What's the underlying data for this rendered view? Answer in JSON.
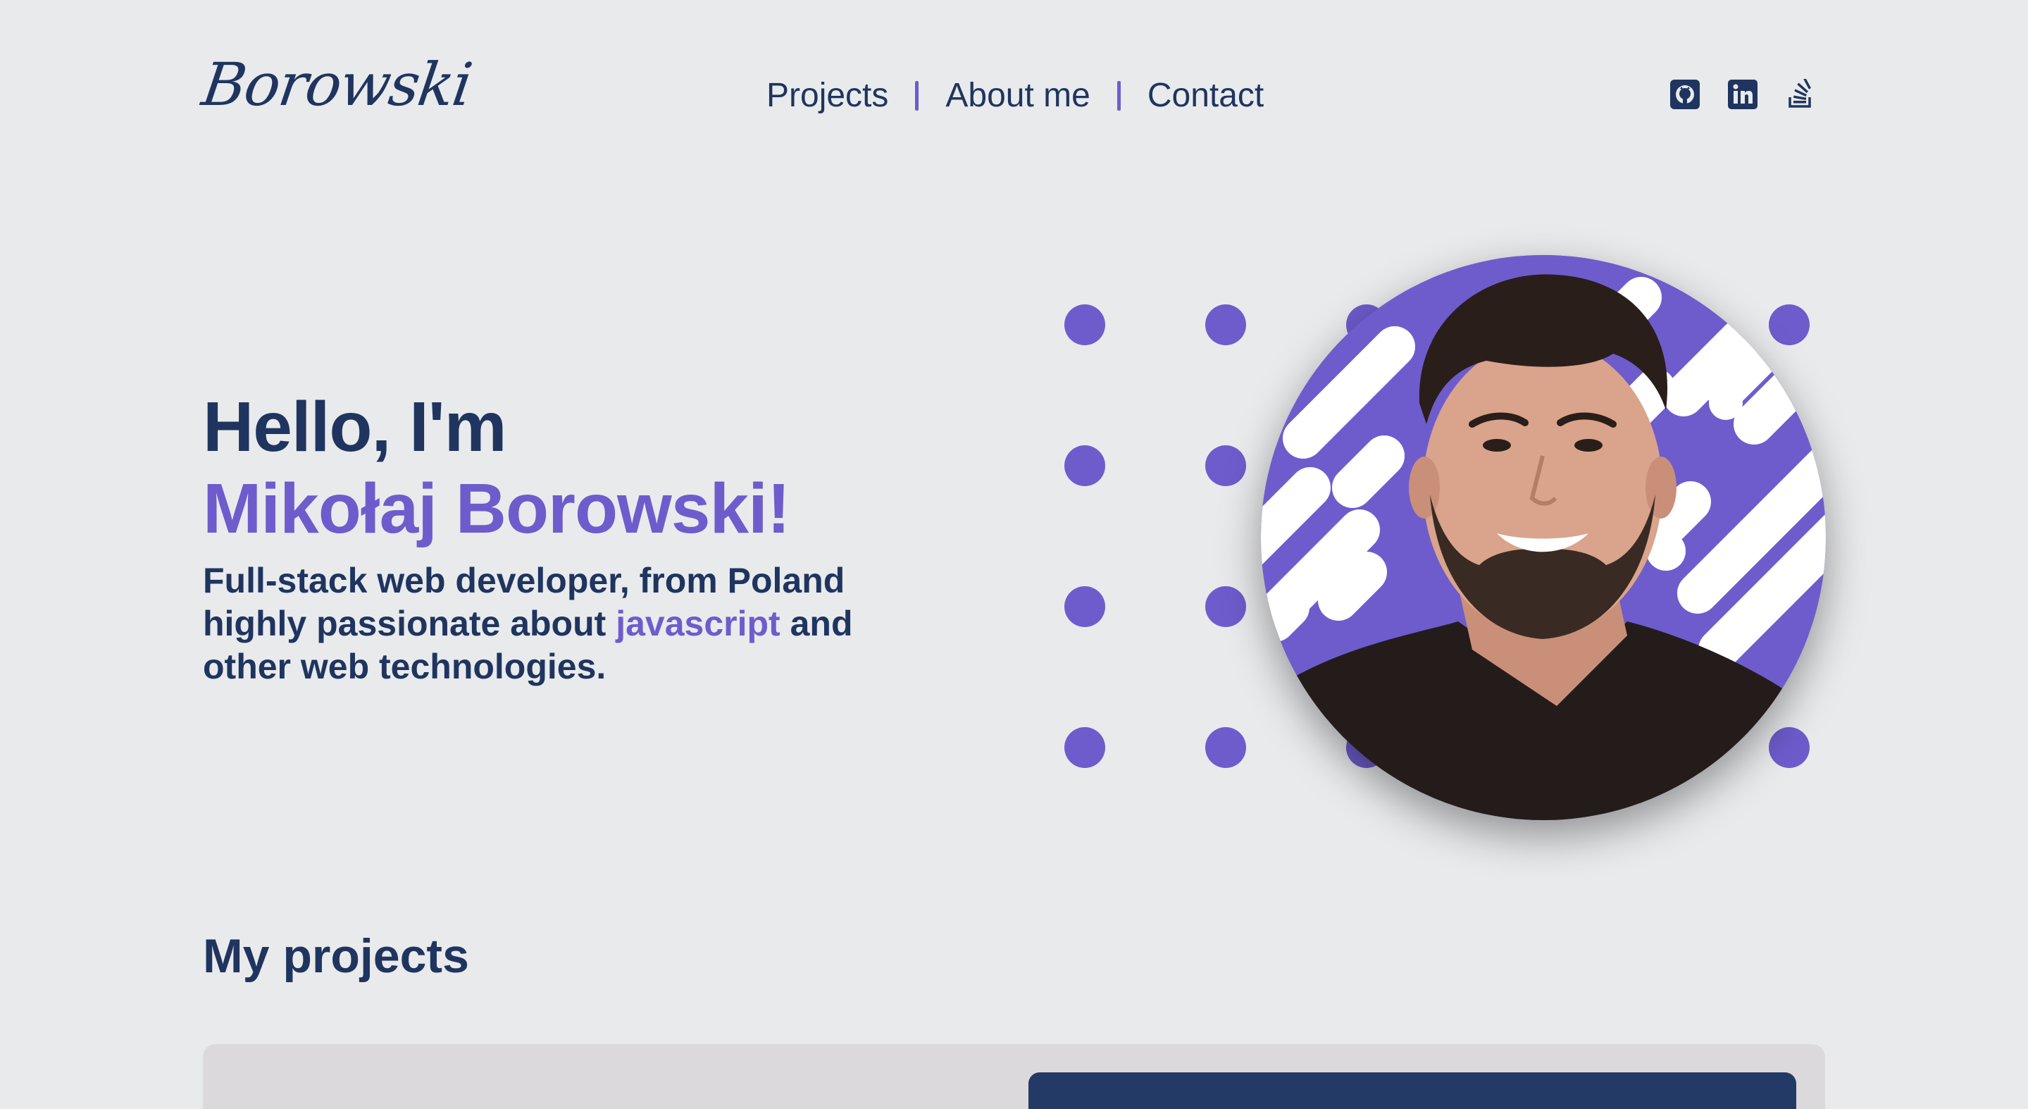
{
  "brand": {
    "logo": "Borowski"
  },
  "nav": {
    "items": [
      {
        "label": "Projects"
      },
      {
        "label": "About me"
      },
      {
        "label": "Contact"
      }
    ]
  },
  "social": [
    {
      "icon": "github-icon"
    },
    {
      "icon": "linkedin-icon"
    },
    {
      "icon": "stackoverflow-icon"
    }
  ],
  "hero": {
    "greeting": "Hello, I'm",
    "name": "Mikołaj Borowski!",
    "tagline_part1": "Full-stack web developer, from Poland highly passionate about",
    "tagline_accent": "javascript",
    "tagline_part2": "and other web technologies."
  },
  "projects": {
    "title": "My projects"
  },
  "colors": {
    "background": "#e9eaec",
    "navy": "#1f355f",
    "accent": "#6e5ccc",
    "card": "#dbd9dc",
    "card_inner": "#243a66"
  }
}
